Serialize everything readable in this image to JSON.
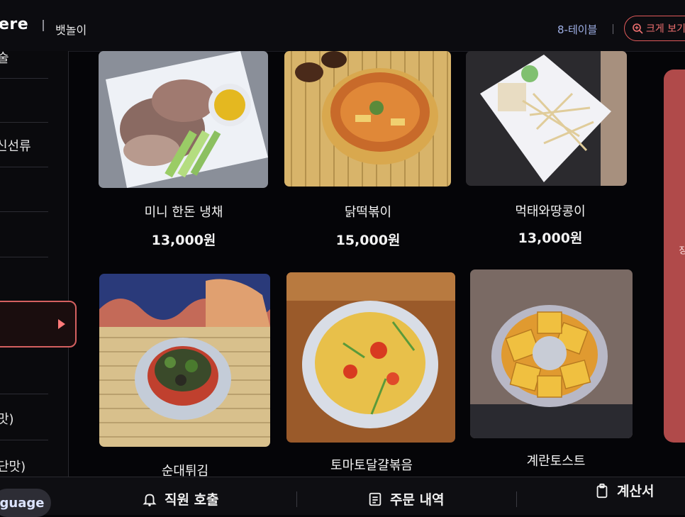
{
  "header": {
    "brand": "ere",
    "store_name": "뱃놀이",
    "table_label": "8-테이블",
    "zoom_label": "크게 보기"
  },
  "sidebar": {
    "categories": [
      "술",
      "신선류",
      "맛)",
      "단맛)"
    ]
  },
  "menu": {
    "items": [
      {
        "name": "미니 한돈 냉채",
        "price": "13,000원"
      },
      {
        "name": "닭떡볶이",
        "price": "15,000원"
      },
      {
        "name": "먹태와땅콩이",
        "price": "13,000원"
      },
      {
        "name": "순대튀김"
      },
      {
        "name": "토마토달걀볶음"
      },
      {
        "name": "계란토스트"
      }
    ]
  },
  "side_panel": {
    "label": "장"
  },
  "footer": {
    "language_label": "guage",
    "call_staff": "직원 호출",
    "order_history": "주문 내역",
    "bill": "계산서"
  },
  "colors": {
    "accent": "#e05a5a",
    "background": "#050508"
  }
}
